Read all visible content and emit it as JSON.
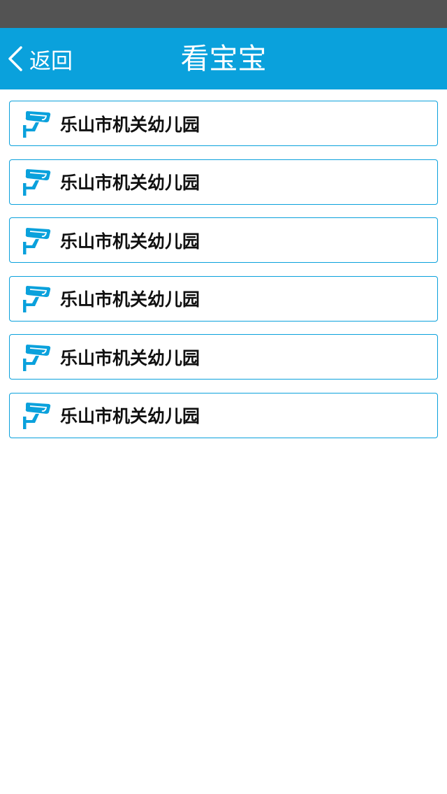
{
  "header": {
    "back_label": "返回",
    "title": "看宝宝"
  },
  "list": {
    "items": [
      {
        "label": "乐山市机关幼儿园",
        "icon": "cctv-camera-icon"
      },
      {
        "label": "乐山市机关幼儿园",
        "icon": "cctv-camera-icon"
      },
      {
        "label": "乐山市机关幼儿园",
        "icon": "cctv-camera-icon"
      },
      {
        "label": "乐山市机关幼儿园",
        "icon": "cctv-camera-icon"
      },
      {
        "label": "乐山市机关幼儿园",
        "icon": "cctv-camera-icon"
      },
      {
        "label": "乐山市机关幼儿园",
        "icon": "cctv-camera-icon"
      }
    ]
  },
  "colors": {
    "status_bar": "#535353",
    "accent": "#0aa1dc",
    "background": "#ffffff",
    "item_text": "#111111"
  }
}
